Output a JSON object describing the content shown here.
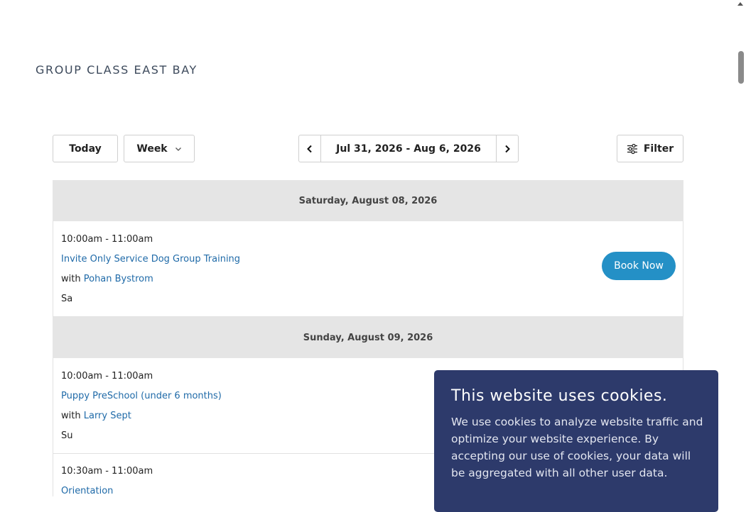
{
  "page": {
    "title": "GROUP CLASS EAST BAY"
  },
  "toolbar": {
    "today_label": "Today",
    "view_label": "Week",
    "date_range": "Jul 31, 2026 - Aug 6, 2026",
    "filter_label": "Filter"
  },
  "days": [
    {
      "header": "Saturday, August 08, 2026",
      "events": [
        {
          "time": "10:00am - 11:00am",
          "name": "Invite Only Service Dog Group Training",
          "with_prefix": "with",
          "instructor": "Pohan Bystrom",
          "day_abbr": "Sa",
          "book_label": "Book Now"
        }
      ]
    },
    {
      "header": "Sunday, August 09, 2026",
      "events": [
        {
          "time": "10:00am - 11:00am",
          "name": "Puppy PreSchool (under 6 months)",
          "with_prefix": "with",
          "instructor": "Larry Sept",
          "day_abbr": "Su"
        },
        {
          "time": "10:30am - 11:00am",
          "name": "Orientation"
        }
      ]
    }
  ],
  "cookie_banner": {
    "title": "This website uses cookies.",
    "text": "We use cookies to analyze website traffic and optimize your website experience. By accepting our use of cookies, your data will be aggregated with all other user data."
  },
  "colors": {
    "link": "#1f6aa8",
    "book_button": "#2490c6",
    "cookie_background": "#2d3a6b",
    "day_header_background": "#e5e5e5"
  },
  "icons": [
    "chevron-down-icon",
    "chevron-left-icon",
    "chevron-right-icon",
    "sliders-icon"
  ]
}
